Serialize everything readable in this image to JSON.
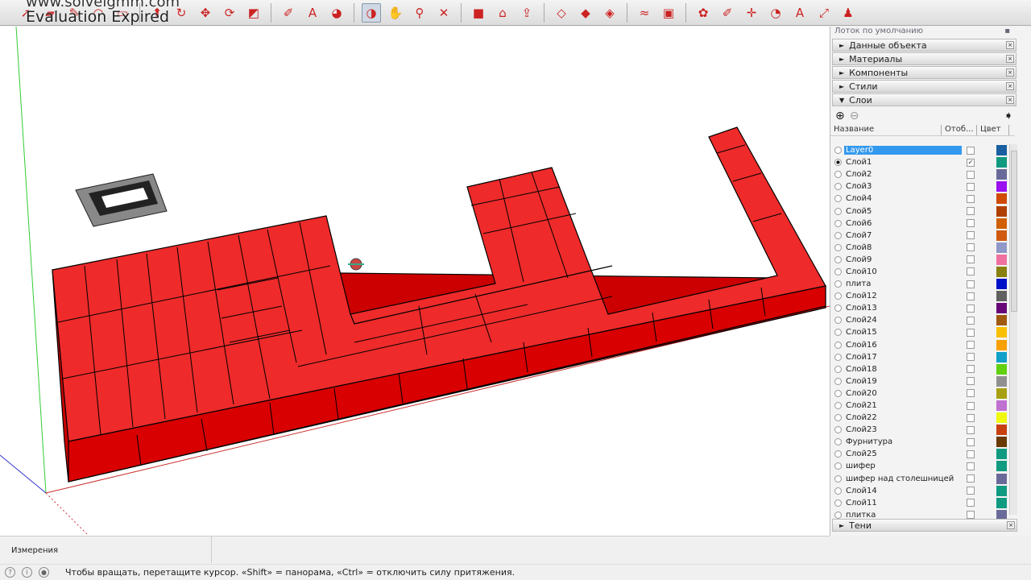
{
  "watermark": {
    "url": "www.solveigmm.com",
    "text": "Evaluation Expired"
  },
  "toolbar": {
    "icons": [
      "select-icon",
      "eraser-icon",
      "pencil-icon",
      "arc-icon",
      "rectangle-icon",
      "push-pull-icon",
      "follow-me-icon",
      "move-icon",
      "rotate-icon",
      "scale-icon",
      "tape-measure-icon",
      "text-icon",
      "paint-bucket-icon",
      "orbit-icon",
      "pan-icon",
      "zoom-icon",
      "zoom-extents-icon",
      "components-icon",
      "warehouse-icon",
      "share-icon",
      "section-icon",
      "top-view-icon",
      "front-view-icon",
      "sandbox-icon",
      "materials-icon",
      "styles-icon",
      "tape-icon",
      "axes-icon",
      "protractor-icon",
      "label-icon",
      "dimension-icon",
      "walk-icon"
    ],
    "active": "orbit-icon"
  },
  "panel": {
    "title": "Лоток по умолчанию",
    "sections": [
      "Данные объекта",
      "Материалы",
      "Компоненты",
      "Стили"
    ],
    "layers_section": "Слои",
    "columns": {
      "name": "Название",
      "visible": "Отоб...",
      "color": "Цвет"
    },
    "layers": [
      {
        "name": "Layer0",
        "color": "#1a5fa0",
        "visible": false,
        "selected": true,
        "active": false
      },
      {
        "name": "Слой1",
        "color": "#129a80",
        "visible": true,
        "active": true
      },
      {
        "name": "Слой2",
        "color": "#6a6a9a",
        "visible": false
      },
      {
        "name": "Слой3",
        "color": "#9a10f0",
        "visible": false
      },
      {
        "name": "Слой4",
        "color": "#d04a00",
        "visible": false
      },
      {
        "name": "Слой5",
        "color": "#b04000",
        "visible": false
      },
      {
        "name": "Слой6",
        "color": "#d06000",
        "visible": false
      },
      {
        "name": "Слой7",
        "color": "#d05a10",
        "visible": false
      },
      {
        "name": "Слой8",
        "color": "#9098c8",
        "visible": false
      },
      {
        "name": "Слой9",
        "color": "#f070a0",
        "visible": false
      },
      {
        "name": "Слой10",
        "color": "#888010",
        "visible": false
      },
      {
        "name": "плита",
        "color": "#0010c8",
        "visible": false
      },
      {
        "name": "Слой12",
        "color": "#606060",
        "visible": false
      },
      {
        "name": "Слой13",
        "color": "#680878",
        "visible": false
      },
      {
        "name": "Слой24",
        "color": "#a05a10",
        "visible": false
      },
      {
        "name": "Слой15",
        "color": "#f8c000",
        "visible": false
      },
      {
        "name": "Слой16",
        "color": "#f8a000",
        "visible": false
      },
      {
        "name": "Слой17",
        "color": "#10a0c8",
        "visible": false
      },
      {
        "name": "Слой18",
        "color": "#60d010",
        "visible": false
      },
      {
        "name": "Слой19",
        "color": "#909090",
        "visible": false
      },
      {
        "name": "Слой20",
        "color": "#a8a010",
        "visible": false
      },
      {
        "name": "Слой21",
        "color": "#c070d0",
        "visible": false
      },
      {
        "name": "Слой22",
        "color": "#f0f810",
        "visible": false
      },
      {
        "name": "Слой23",
        "color": "#c84010",
        "visible": false
      },
      {
        "name": "Фурнитура",
        "color": "#6a3a00",
        "visible": false
      },
      {
        "name": "Слой25",
        "color": "#109a80",
        "visible": false
      },
      {
        "name": "шифер",
        "color": "#109a80",
        "visible": false
      },
      {
        "name": "шифер над столешницей",
        "color": "#6a6a9a",
        "visible": false
      },
      {
        "name": "Слой14",
        "color": "#109a80",
        "visible": false
      },
      {
        "name": "Слой11",
        "color": "#109a80",
        "visible": false
      },
      {
        "name": "плитка",
        "color": "#6a6a9a",
        "visible": false
      }
    ],
    "shadows": "Тени"
  },
  "measurements": {
    "label": "Измерения",
    "value": ""
  },
  "status": {
    "text": "Чтобы вращать, перетащите курсор. «Shift» = панорама, «Ctrl» = отключить силу притяжения."
  },
  "colors": {
    "brick": "#ee2020",
    "brick_side": "#cc0000",
    "selection": "#3399ee"
  }
}
